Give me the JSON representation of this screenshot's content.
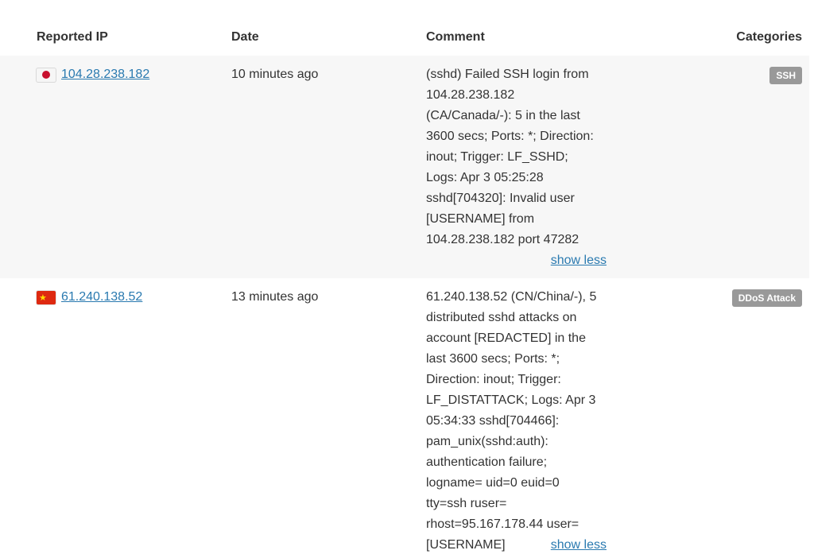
{
  "table": {
    "headers": {
      "ip": "Reported IP",
      "date": "Date",
      "comment": "Comment",
      "categories": "Categories"
    },
    "rows": [
      {
        "flag": "jp-flag-icon",
        "ip": "104.28.238.182",
        "date": "10 minutes ago",
        "comment_lines": [
          "(sshd) Failed SSH login from",
          "104.28.238.182",
          "(CA/Canada/-): 5 in the last",
          "3600 secs; Ports: *; Direction:",
          "inout; Trigger: LF_SSHD;",
          "Logs: Apr 3 05:25:28",
          "sshd[704320]: Invalid user",
          "[USERNAME] from",
          "104.28.238.182 port 47282"
        ],
        "toggle": "show less",
        "category": "SSH"
      },
      {
        "flag": "cn-flag-icon",
        "ip": "61.240.138.52",
        "date": "13 minutes ago",
        "comment_lines": [
          "61.240.138.52 (CN/China/-), 5",
          "distributed sshd attacks on",
          "account [REDACTED] in the",
          "last 3600 secs; Ports: *;",
          "Direction: inout; Trigger:",
          "LF_DISTATTACK; Logs: Apr 3",
          "05:34:33 sshd[704466]:",
          "pam_unix(sshd:auth):",
          "authentication failure;",
          "logname= uid=0 euid=0",
          "tty=ssh ruser=",
          "rhost=95.167.178.44 user=",
          "[USERNAME]"
        ],
        "toggle": "show less",
        "category": "DDoS Attack"
      }
    ]
  }
}
